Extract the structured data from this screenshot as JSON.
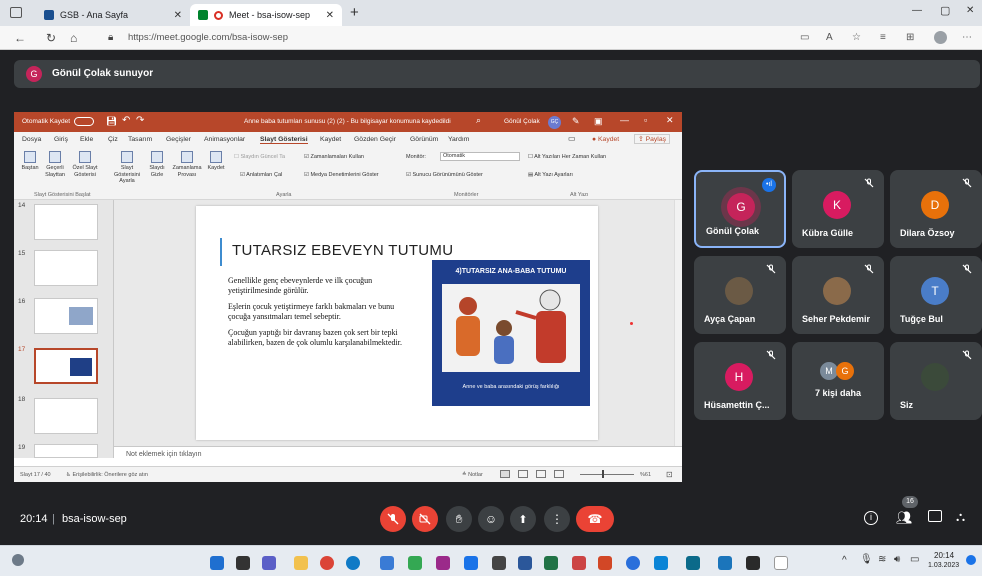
{
  "browser": {
    "tabs": [
      {
        "title": "GSB - Ana Sayfa"
      },
      {
        "title": "Meet - bsa-isow-sep"
      }
    ],
    "new_tab": "+",
    "url": "https://meet.google.com/bsa-isow-sep",
    "window_controls": [
      "—",
      "▢",
      "✕"
    ]
  },
  "meet": {
    "presenter_banner": "Gönül Çolak sunuyor",
    "presenter_initial": "G",
    "time": "20:14",
    "meeting_code": "bsa-isow-sep",
    "people_count": "16",
    "participants": [
      {
        "name": "Gönül Çolak",
        "initial": "G",
        "color": "#c5245a",
        "speaking": true
      },
      {
        "name": "Kübra Gülle",
        "initial": "K",
        "color": "#d81b60",
        "speaking": false
      },
      {
        "name": "Dilara Özsoy",
        "initial": "D",
        "color": "#e8710a",
        "speaking": false
      },
      {
        "name": "Ayça Çapan",
        "initial": "",
        "color": "#6b5a45",
        "speaking": false
      },
      {
        "name": "Seher Pekdemir",
        "initial": "",
        "color": "#8a6a4a",
        "speaking": false
      },
      {
        "name": "Tuğçe Bul",
        "initial": "T",
        "color": "#4a7dc8",
        "speaking": false
      },
      {
        "name": "Hüsamettin Ç...",
        "initial": "H",
        "color": "#d81b60",
        "speaking": false
      },
      {
        "name": "7 kişi daha",
        "initial": "",
        "color": "",
        "speaking": false
      },
      {
        "name": "Siz",
        "initial": "",
        "color": "#3b4a3a",
        "speaking": false
      }
    ],
    "more_avatars": [
      "M",
      "G"
    ]
  },
  "powerpoint": {
    "autosave_label": "Otomatik Kaydet",
    "doc_title": "Anne baba tutumları sunusu (2) (2) - Bu bilgisayar konumuna kaydedildi",
    "user_name": "Gönül Çolak",
    "user_initials": "GÇ",
    "menu": [
      "Dosya",
      "Giriş",
      "Ekle",
      "Çiz",
      "Tasarım",
      "Geçişler",
      "Animasyonlar",
      "Slayt Gösterisi",
      "Kaydet",
      "Gözden Geçir",
      "Görünüm",
      "Yardım"
    ],
    "save_button": "Kaydet",
    "share_button": "Paylaş",
    "ribbon": {
      "start_group": [
        {
          "label": "Baştan"
        },
        {
          "label": "Geçerli Slayttan"
        },
        {
          "label": "Özel Slayt Gösterisi"
        },
        {
          "label": "Slayt Gösterisini Ayarla"
        },
        {
          "label": "Slaydı Gizle"
        },
        {
          "label": "Zamanlama Provası"
        },
        {
          "label": "Kaydet"
        }
      ],
      "group_start": "Slayt Gösterisini Başlat",
      "group_setup": "Ayarla",
      "group_monitors": "Monitörler",
      "group_captions": "Alt Yazı",
      "check_timings_current": "Slaydın Güncel Ta",
      "check_timings": "Zamanlamaları Kullan",
      "check_narrations": "Anlatımları Çal",
      "check_media": "Medya Denetimlerini Göster",
      "monitor_label": "Monitör:",
      "monitor_value": "Otomatik",
      "presenter_view": "Sunucu Görünümünü Göster",
      "always_subtitles": "Alt Yazıları Her Zaman Kullan",
      "subtitle_settings": "Alt Yazı Ayarları"
    },
    "slide_numbers": [
      "14",
      "15",
      "16",
      "17",
      "18",
      "19"
    ],
    "slide": {
      "title": "TUTARSIZ EBEVEYN TUTUMU",
      "p1": "Genellikle genç ebeveynlerde ve ilk çocuğun yetiştirilmesinde görülür.",
      "p2": "Eşlerin çocuk yetiştirmeye farklı bakmaları ve bunu çocuğa yansıtmaları temel sebeptir.",
      "p3": "Çocuğun yaptığı bir davranış bazen çok sert bir tepki alabilirken, bazen de çok olumlu karşılanabilmektedir.",
      "image_title": "4)TUTARSIZ ANA-BABA TUTUMU",
      "image_caption": "Anne ve baba arasındaki görüş farklılığı"
    },
    "notes_placeholder": "Not eklemek için tıklayın",
    "status_left": "Slayt 17 / 40",
    "status_access": "Erişilebilirlik: Önerilere göz atın",
    "status_notes": "Notlar",
    "zoom": "%61"
  },
  "taskbar": {
    "clock": "20:14",
    "date": "1.03.2023"
  },
  "colors": {
    "meet_bg": "#202124",
    "ppt_accent": "#b7472a",
    "end_call": "#ea4335"
  }
}
